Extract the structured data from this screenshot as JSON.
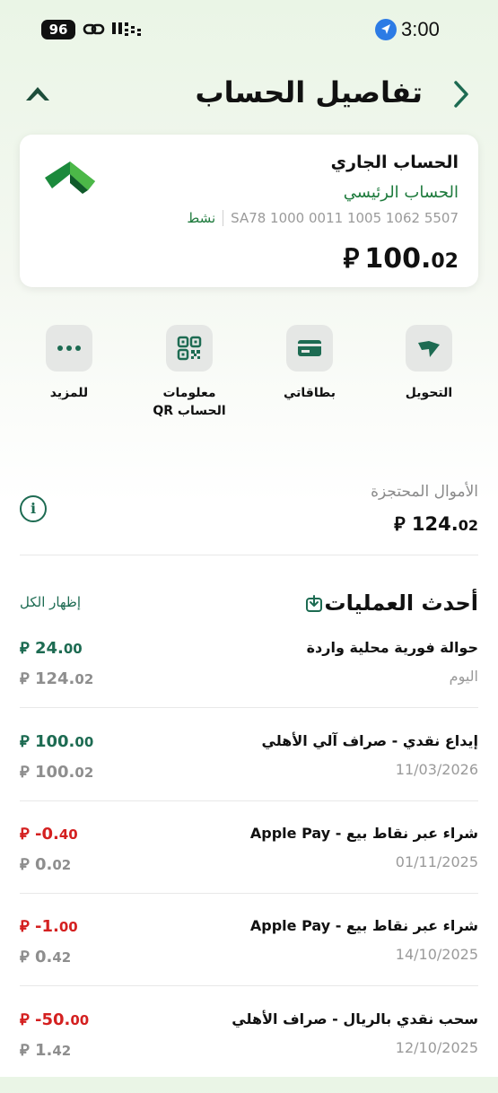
{
  "status_bar": {
    "battery": "96",
    "time": "3:00"
  },
  "header": {
    "title": "تفاصيل الحساب"
  },
  "account": {
    "name": "الحساب الجاري",
    "subtitle": "الحساب الرئيسي",
    "iban": "SA78 1000 0011 1005 1062 5507",
    "status": "نشط",
    "balance_int": "100.",
    "balance_dec": "02",
    "currency": "⃁"
  },
  "actions": {
    "transfer": "التحويل",
    "cards": "بطاقاتي",
    "qr_line1": "معلومات",
    "qr_line2": "الحساب QR",
    "more": "للمزيد"
  },
  "reserved": {
    "label": "الأموال المحتجزة",
    "amount_int": "124.",
    "amount_dec": "02"
  },
  "transactions_section": {
    "title": "أحدث العمليات",
    "show_all": "إظهار الكل"
  },
  "transactions": [
    {
      "desc": "حوالة فورية محلية واردة",
      "date": "اليوم",
      "amount_int": "24.",
      "amount_dec": "00",
      "balance_int": "124.",
      "balance_dec": "02",
      "sign": "pos"
    },
    {
      "desc": "إيداع نقدي - صراف آلي الأهلي",
      "date": "11/03/2026",
      "amount_int": "100.",
      "amount_dec": "00",
      "balance_int": "100.",
      "balance_dec": "02",
      "sign": "pos"
    },
    {
      "desc": "شراء عبر نقاط بيع - Apple Pay",
      "date": "01/11/2025",
      "amount_int": "-0.",
      "amount_dec": "40",
      "balance_int": "0.",
      "balance_dec": "02",
      "sign": "neg"
    },
    {
      "desc": "شراء عبر نقاط بيع - Apple Pay",
      "date": "14/10/2025",
      "amount_int": "-1.",
      "amount_dec": "00",
      "balance_int": "0.",
      "balance_dec": "42",
      "sign": "neg"
    },
    {
      "desc": "سحب نقدي بالريال - صراف الأهلي",
      "date": "12/10/2025",
      "amount_int": "-50.",
      "amount_dec": "00",
      "balance_int": "1.",
      "balance_dec": "42",
      "sign": "neg"
    }
  ],
  "colors": {
    "brand_green": "#1d6b52",
    "accent_green": "#1d7a3c",
    "negative_red": "#d42020"
  }
}
